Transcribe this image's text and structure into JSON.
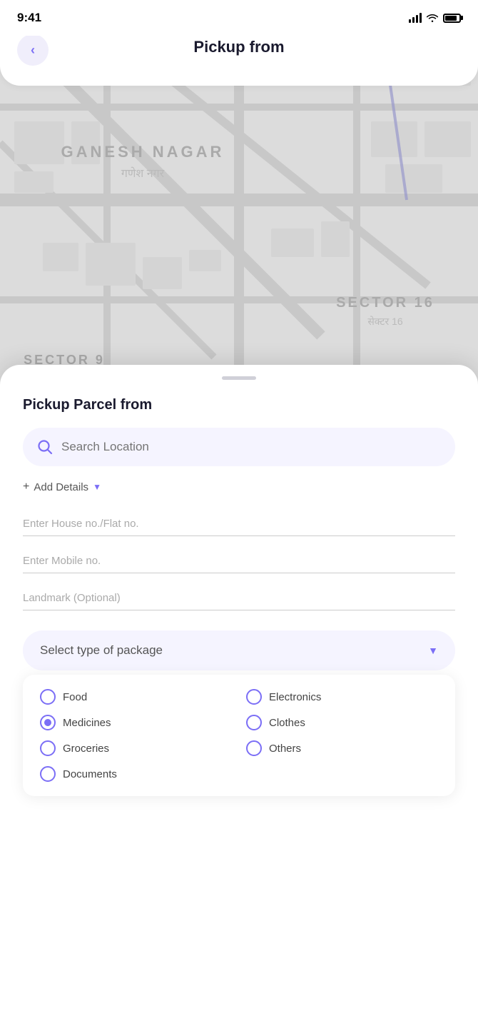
{
  "statusBar": {
    "time": "9:41"
  },
  "header": {
    "backLabel": "‹",
    "title": "Pickup from"
  },
  "map": {
    "areaLabel": "GANESH NAGAR",
    "areaLabelHindi": "गणेश नगर",
    "sectorLabel": "SECTOR 16",
    "sectorLabelHindi": "सेक्टर 16",
    "sector9Label": "SECTOR 9"
  },
  "bottomSheet": {
    "sectionTitle": "Pickup Parcel from",
    "searchPlaceholder": "Search Location",
    "addDetailsLabel": "Add Details",
    "addDetailsPlus": "+",
    "fields": [
      {
        "placeholder": "Enter House no./Flat no.",
        "id": "house-field"
      },
      {
        "placeholder": "Enter Mobile no.",
        "id": "mobile-field"
      },
      {
        "placeholder": "Landmark (Optional)",
        "id": "landmark-field"
      }
    ],
    "packageSelector": {
      "label": "Select type of package"
    },
    "packageOptions": [
      {
        "label": "Food",
        "selected": false,
        "id": "food"
      },
      {
        "label": "Electronics",
        "selected": false,
        "id": "electronics"
      },
      {
        "label": "Medicines",
        "selected": true,
        "id": "medicines"
      },
      {
        "label": "Clothes",
        "selected": false,
        "id": "clothes"
      },
      {
        "label": "Groceries",
        "selected": false,
        "id": "groceries"
      },
      {
        "label": "Others",
        "selected": false,
        "id": "others"
      },
      {
        "label": "Documents",
        "selected": false,
        "id": "documents"
      }
    ]
  },
  "colors": {
    "accent": "#7B6EF6",
    "accentLight": "#f5f4ff",
    "textDark": "#1a1a2e",
    "textGray": "#888"
  }
}
